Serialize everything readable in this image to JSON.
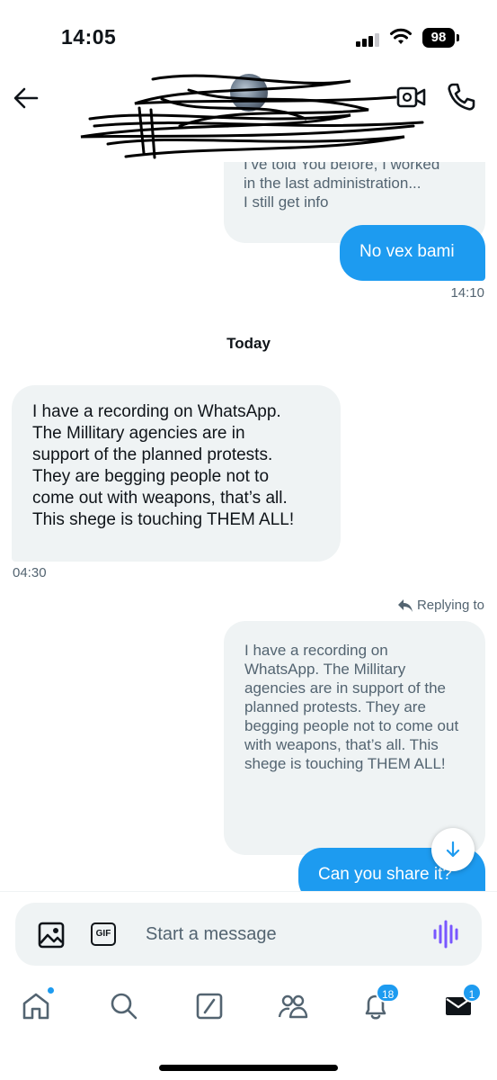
{
  "status_bar": {
    "time": "14:05",
    "battery": "98",
    "icons": [
      "signal-icon",
      "wifi-icon",
      "battery-icon"
    ]
  },
  "header": {
    "contact_name": "[redacted]",
    "icons": {
      "back": "back-arrow-icon",
      "video": "video-camera-icon",
      "call": "phone-icon"
    }
  },
  "messages": {
    "prev_outgoing_text": "I’ve told You before, I worked\nin the last administration...\nI still get info",
    "outgoing_1": "No vex bami",
    "outgoing_1_time": "14:10",
    "day_separator": "Today",
    "incoming_1": "I have a recording on WhatsApp.\nThe Millitary agencies are in\nsupport of the planned protests.\nThey are begging people not to\ncome out with weapons, that’s all.\nThis shege is touching THEM ALL!",
    "incoming_1_time": "04:30",
    "replying_label": "Replying to",
    "reply_quote": "I have a recording on\nWhatsApp.\nThe Millitary agencies are in\nsupport of the planned\nprotests.\nThey are begging people not\nto come out with weapons,\nthat’s all.\nThis shege is touching THEM\nALL!",
    "outgoing_2": "Can you share it?"
  },
  "composer": {
    "placeholder": "Start a message",
    "gif_label": "GIF"
  },
  "tab_bar": {
    "notifications_badge": "18",
    "messages_badge": "1"
  },
  "colors": {
    "accent": "#1d9bf0",
    "bubble_gray": "#eff3f4",
    "muted_text": "#536471",
    "voice_icon": "#7856ff"
  }
}
